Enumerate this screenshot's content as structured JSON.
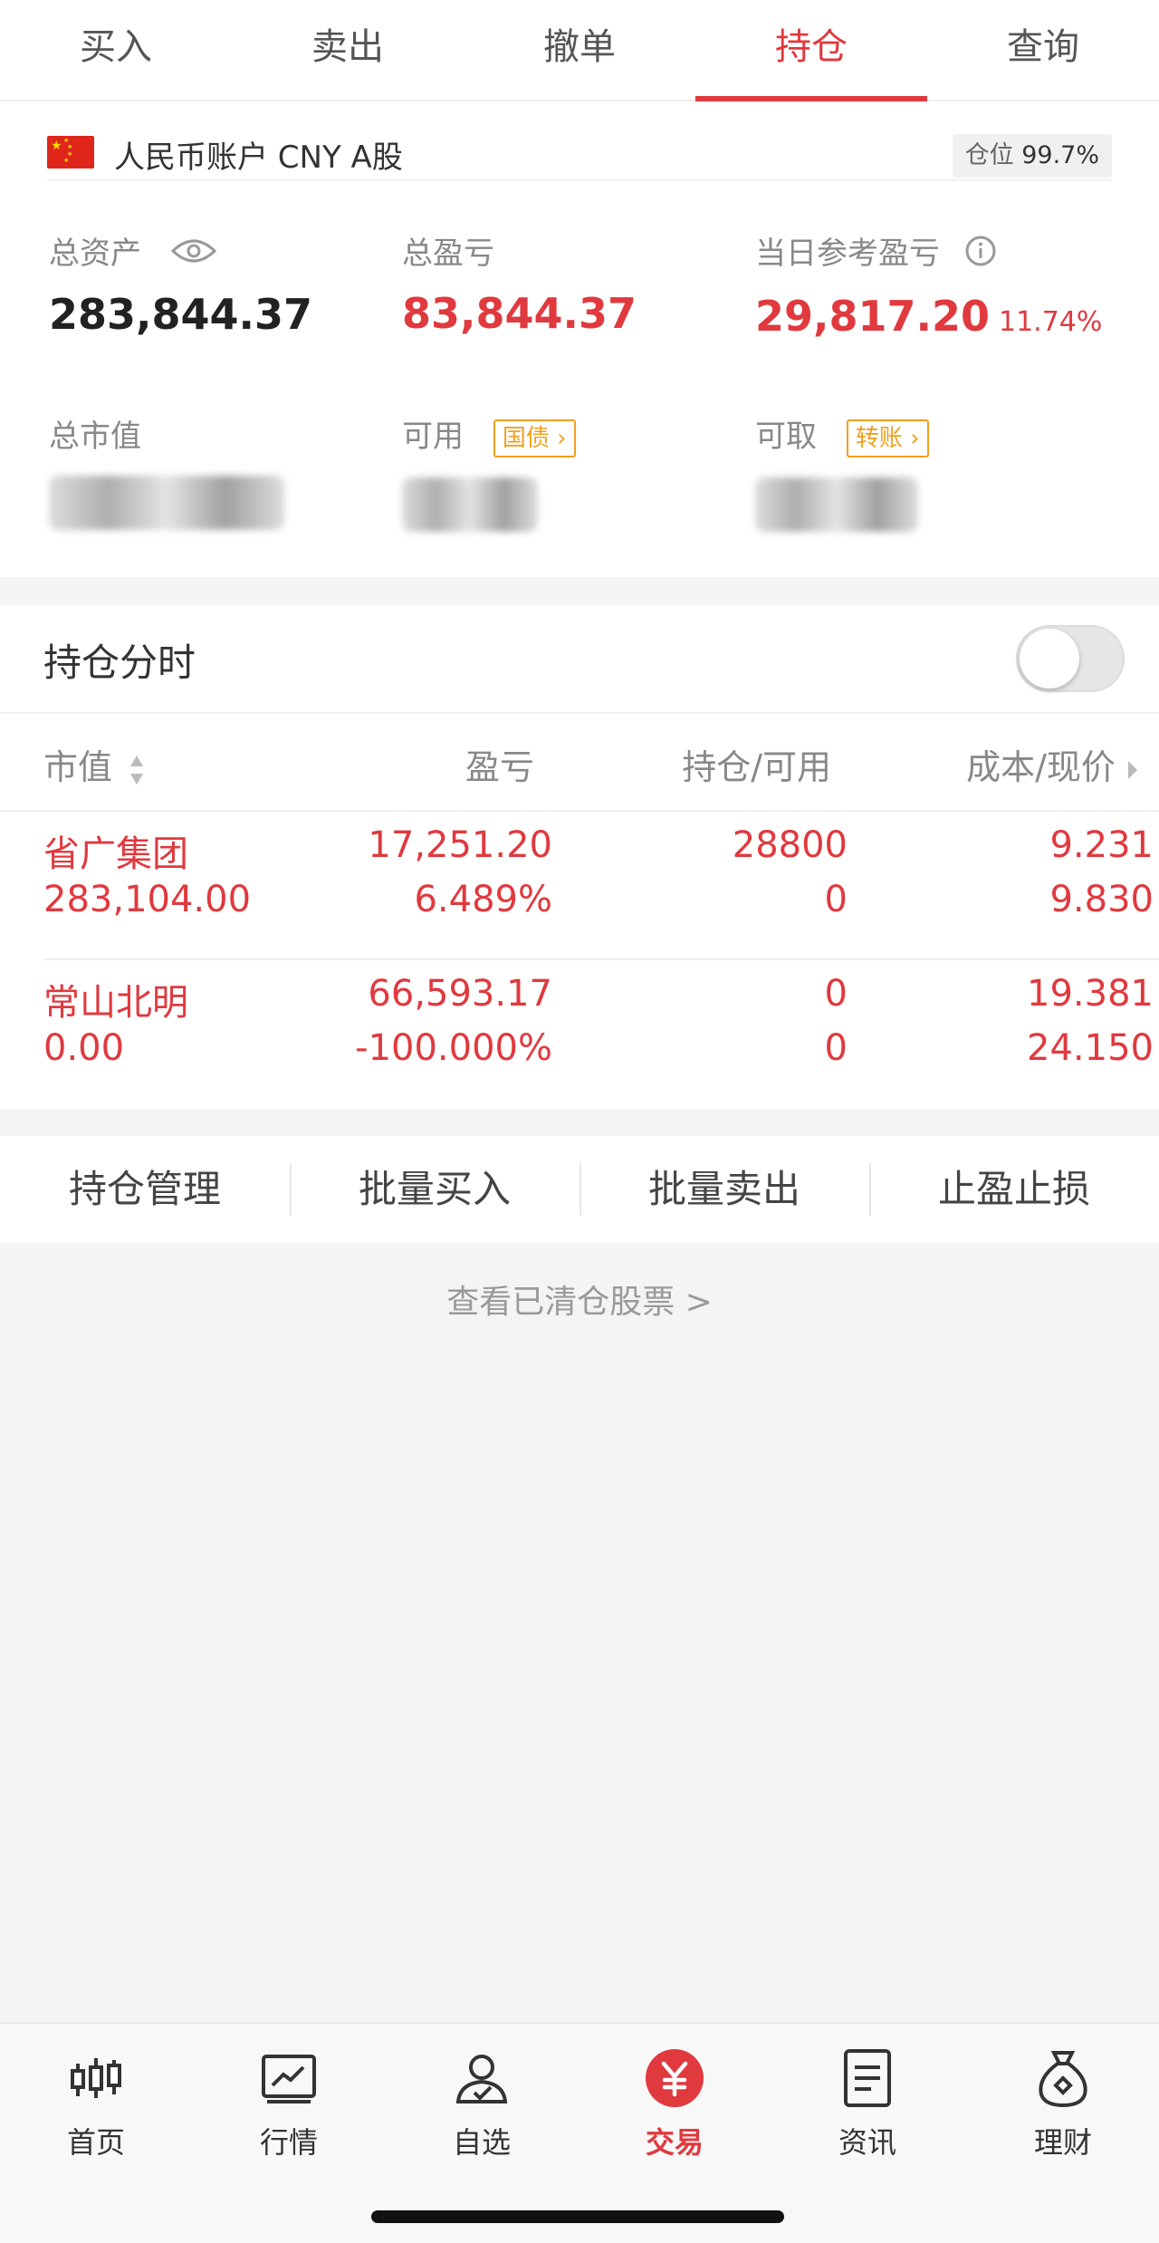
{
  "tabs": [
    {
      "label": "买入"
    },
    {
      "label": "卖出"
    },
    {
      "label": "撤单"
    },
    {
      "label": "持仓"
    },
    {
      "label": "查询"
    }
  ],
  "account": {
    "name": "人民币账户 CNY A股",
    "position_label": "仓位",
    "position_value": "99.7%"
  },
  "stats": {
    "total_assets_label": "总资产",
    "total_assets": "283,844.37",
    "total_pnl_label": "总盈亏",
    "total_pnl": "83,844.37",
    "daily_pnl_label": "当日参考盈亏",
    "daily_pnl": "29,817.20",
    "daily_pnl_pct": "11.74%",
    "market_value_label": "总市值",
    "available_label": "可用",
    "available_tag": "国债",
    "withdrawable_label": "可取",
    "withdrawable_tag": "转账"
  },
  "holdings": {
    "title": "持仓分时",
    "toggle_on": false,
    "headers": {
      "market_value": "市值",
      "pnl": "盈亏",
      "position_available": "持仓/可用",
      "cost_price": "成本/现价"
    },
    "rows": [
      {
        "name": "省广集团",
        "market_value": "283,104.00",
        "pnl": "17,251.20",
        "pnl_pct": "6.489%",
        "position": "28800",
        "available": "0",
        "cost": "9.231",
        "price": "9.830"
      },
      {
        "name": "常山北明",
        "market_value": "0.00",
        "pnl": "66,593.17",
        "pnl_pct": "-100.000%",
        "position": "0",
        "available": "0",
        "cost": "19.381",
        "price": "24.150"
      }
    ]
  },
  "actions": [
    {
      "label": "持仓管理"
    },
    {
      "label": "批量买入"
    },
    {
      "label": "批量卖出"
    },
    {
      "label": "止盈止损"
    }
  ],
  "cleared_link": "查看已清仓股票 >",
  "bottom_nav": [
    {
      "label": "首页",
      "icon": "candlestick-icon"
    },
    {
      "label": "行情",
      "icon": "chart-line-icon"
    },
    {
      "label": "自选",
      "icon": "person-check-icon"
    },
    {
      "label": "交易",
      "icon": "yuan-icon"
    },
    {
      "label": "资讯",
      "icon": "document-icon"
    },
    {
      "label": "理财",
      "icon": "money-bag-icon"
    }
  ],
  "colors": {
    "accent_red": "#e0393e",
    "tag_orange": "#f0a020"
  }
}
